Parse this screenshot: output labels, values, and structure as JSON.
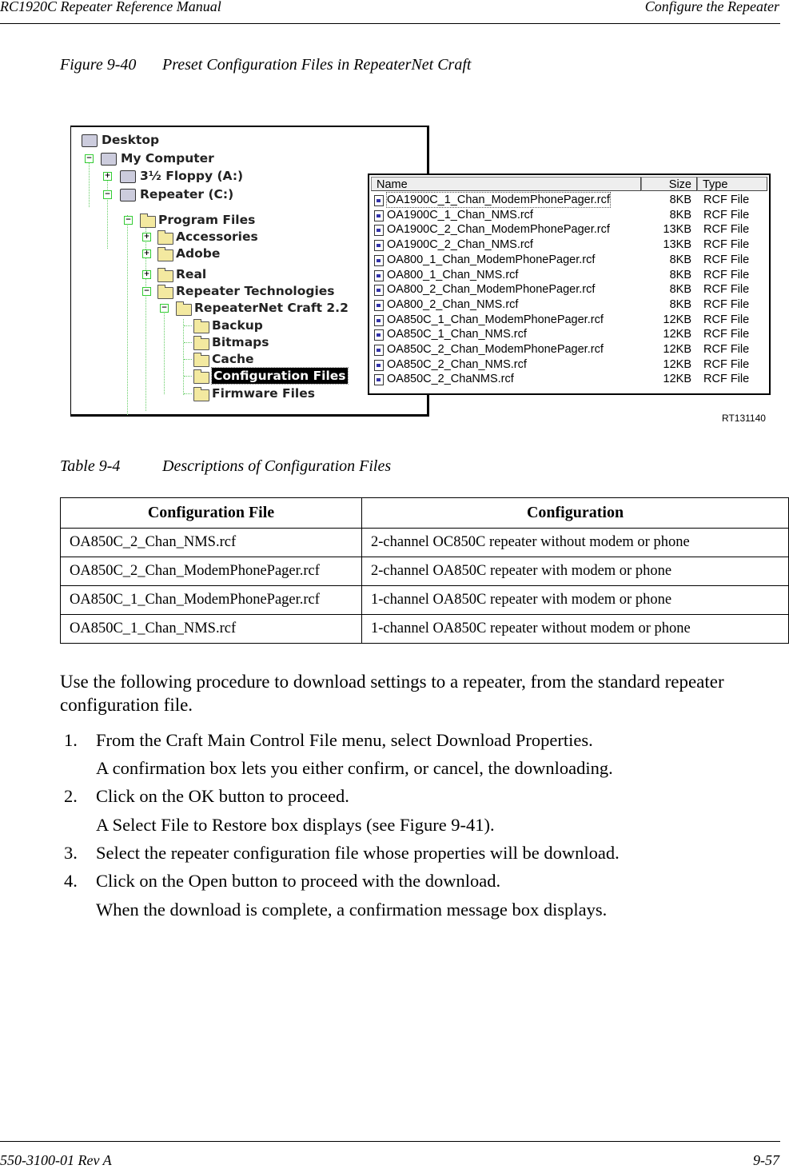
{
  "header": {
    "left": "RC1920C Repeater Reference Manual",
    "right": "Configure the Repeater"
  },
  "figure": {
    "label": "Figure 9-40",
    "title": "Preset Configuration Files in RepeaterNet Craft",
    "code": "RT131140"
  },
  "tree": {
    "items": [
      {
        "label": "Desktop",
        "icon": "desktop-icon",
        "expander": ""
      },
      {
        "label": "My Computer",
        "icon": "computer-icon",
        "expander": "minus"
      },
      {
        "label": "3½ Floppy (A:)",
        "icon": "floppy-drive-icon",
        "expander": "plus"
      },
      {
        "label": "Repeater (C:)",
        "icon": "hard-drive-icon",
        "expander": "minus"
      },
      {
        "label": "Program Files",
        "icon": "folder-icon",
        "expander": "minus"
      },
      {
        "label": "Accessories",
        "icon": "folder-icon",
        "expander": "plus"
      },
      {
        "label": "Adobe",
        "icon": "folder-icon",
        "expander": "plus"
      },
      {
        "label": "Real",
        "icon": "folder-icon",
        "expander": "plus"
      },
      {
        "label": "Repeater Technologies",
        "icon": "folder-icon",
        "expander": "minus"
      },
      {
        "label": "RepeaterNet Craft 2.2",
        "icon": "folder-icon",
        "expander": "minus"
      },
      {
        "label": "Backup",
        "icon": "folder-icon",
        "expander": ""
      },
      {
        "label": "Bitmaps",
        "icon": "folder-icon",
        "expander": ""
      },
      {
        "label": "Cache",
        "icon": "folder-icon",
        "expander": ""
      },
      {
        "label": "Configuration Files",
        "icon": "open-folder-icon",
        "expander": "",
        "selected": true
      },
      {
        "label": "Firmware Files",
        "icon": "folder-icon",
        "expander": ""
      }
    ]
  },
  "filelist": {
    "columns": {
      "name": "Name",
      "size": "Size",
      "type": "Type"
    },
    "rows": [
      {
        "name": "OA1900C_1_Chan_ModemPhonePager.rcf",
        "size": "8KB",
        "type": "RCF File"
      },
      {
        "name": "OA1900C_1_Chan_NMS.rcf",
        "size": "8KB",
        "type": "RCF File"
      },
      {
        "name": "OA1900C_2_Chan_ModemPhonePager.rcf",
        "size": "13KB",
        "type": "RCF File"
      },
      {
        "name": "OA1900C_2_Chan_NMS.rcf",
        "size": "13KB",
        "type": "RCF File"
      },
      {
        "name": "OA800_1_Chan_ModemPhonePager.rcf",
        "size": "8KB",
        "type": "RCF File"
      },
      {
        "name": "OA800_1_Chan_NMS.rcf",
        "size": "8KB",
        "type": "RCF File"
      },
      {
        "name": "OA800_2_Chan_ModemPhonePager.rcf",
        "size": "8KB",
        "type": "RCF File"
      },
      {
        "name": "OA800_2_Chan_NMS.rcf",
        "size": "8KB",
        "type": "RCF File"
      },
      {
        "name": "OA850C_1_Chan_ModemPhonePager.rcf",
        "size": "12KB",
        "type": "RCF File"
      },
      {
        "name": "OA850C_1_Chan_NMS.rcf",
        "size": "12KB",
        "type": "RCF File"
      },
      {
        "name": "OA850C_2_Chan_ModemPhonePager.rcf",
        "size": "12KB",
        "type": "RCF File"
      },
      {
        "name": "OA850C_2_Chan_NMS.rcf",
        "size": "12KB",
        "type": "RCF File"
      },
      {
        "name": "OA850C_2_ChaNMS.rcf",
        "size": "12KB",
        "type": "RCF File"
      }
    ]
  },
  "table": {
    "label": "Table 9-4",
    "title": "Descriptions of Configuration Files",
    "headers": [
      "Configuration File",
      "Configuration"
    ],
    "rows": [
      [
        "OA850C_2_Chan_NMS.rcf",
        "2-channel OC850C repeater without modem or phone"
      ],
      [
        "OA850C_2_Chan_ModemPhonePager.rcf",
        "2-channel OA850C repeater with modem or phone"
      ],
      [
        "OA850C_1_Chan_ModemPhonePager.rcf",
        "1-channel OA850C repeater with modem or phone"
      ],
      [
        "OA850C_1_Chan_NMS.rcf",
        "1-channel OA850C repeater without modem or phone"
      ]
    ]
  },
  "intro": "Use the following procedure to download settings to a repeater, from the standard repeater configuration file.",
  "steps": [
    {
      "num": "1.",
      "text": "From the Craft Main Control File menu, select Download Properties."
    },
    {
      "num": "",
      "text": "A confirmation box lets you either confirm, or cancel, the downloading."
    },
    {
      "num": "2.",
      "text": "Click on the OK button to proceed."
    },
    {
      "num": "",
      "text": "A Select File to Restore box displays (see Figure 9-41)."
    },
    {
      "num": "3.",
      "text": "Select the repeater configuration file whose properties will be download."
    },
    {
      "num": "4.",
      "text": "Click on the Open button to proceed with the download."
    },
    {
      "num": "",
      "text": "When the download is complete, a confirmation message box displays."
    }
  ],
  "footer": {
    "left": "550-3100-01 Rev A",
    "right": "9-57"
  }
}
